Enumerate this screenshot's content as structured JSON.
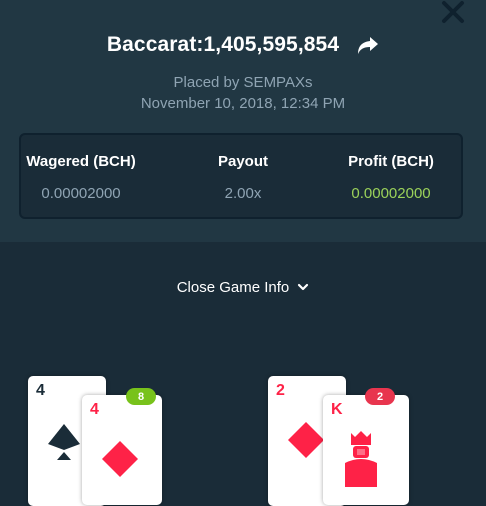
{
  "header": {
    "title": "Baccarat:1,405,595,854",
    "placed_by": "Placed by SEMPAXs",
    "date": "November 10, 2018, 12:34 PM"
  },
  "stats": {
    "wagered": {
      "label": "Wagered (BCH)",
      "value": "0.00002000"
    },
    "payout": {
      "label": "Payout",
      "value": "2.00x"
    },
    "profit": {
      "label": "Profit (BCH)",
      "value": "0.00002000"
    }
  },
  "game_info": {
    "label": "Close Game Info"
  },
  "player_hand": {
    "score": "8",
    "cards": [
      {
        "rank": "4",
        "suit": "spades"
      },
      {
        "rank": "4",
        "suit": "diamonds"
      }
    ]
  },
  "banker_hand": {
    "score": "2",
    "cards": [
      {
        "rank": "2",
        "suit": "diamonds"
      },
      {
        "rank": "K",
        "suit": "king-figure"
      }
    ]
  },
  "colors": {
    "winner_badge": "#78c21b",
    "loser_badge": "#e8354e",
    "profit_green": "#9bd25a",
    "red_suit": "#fe2247"
  },
  "icons": [
    "close-icon",
    "share-icon",
    "chevron-down-icon",
    "spade-icon",
    "diamond-icon",
    "king-figure-icon"
  ]
}
